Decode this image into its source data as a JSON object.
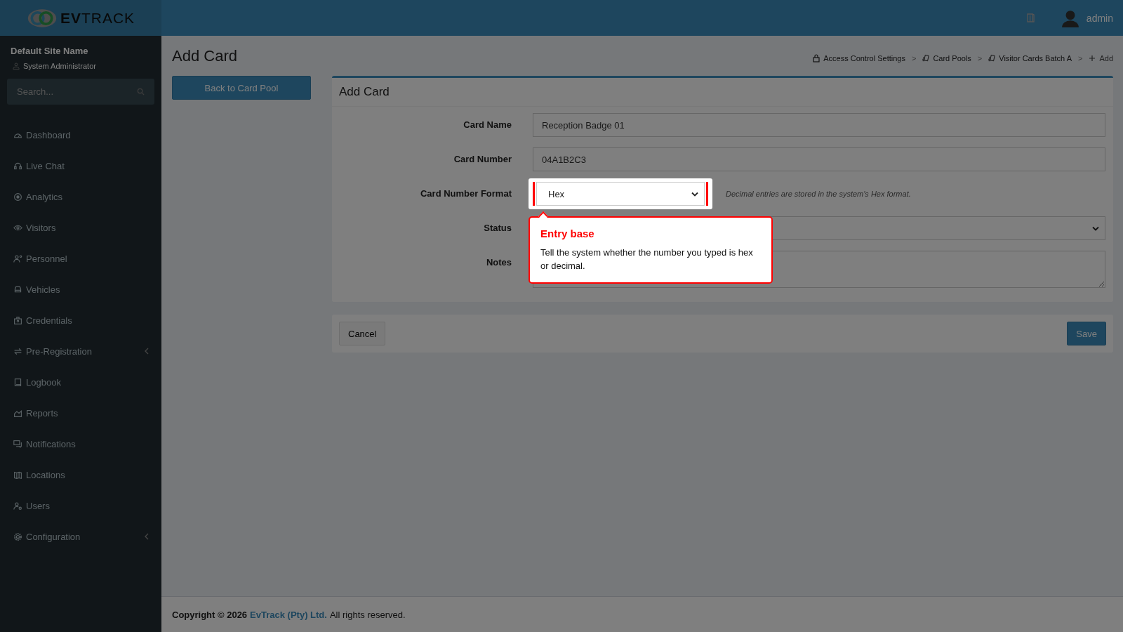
{
  "header": {
    "logo_text": "**EV**TRACK",
    "user": "admin"
  },
  "sidebar": {
    "site_name": "Default Site Name",
    "role": "System Administrator",
    "search": {
      "placeholder": "Search..."
    },
    "items": [
      {
        "label": "Dashboard",
        "has_submenu": false
      },
      {
        "label": "Live Chat",
        "has_submenu": false
      },
      {
        "label": "Analytics",
        "has_submenu": false
      },
      {
        "label": "Visitors",
        "has_submenu": false
      },
      {
        "label": "Personnel",
        "has_submenu": false
      },
      {
        "label": "Vehicles",
        "has_submenu": false
      },
      {
        "label": "Credentials",
        "has_submenu": false
      },
      {
        "label": "Pre-Registration",
        "has_submenu": true
      },
      {
        "label": "Logbook",
        "has_submenu": false
      },
      {
        "label": "Reports",
        "has_submenu": false
      },
      {
        "label": "Notifications",
        "has_submenu": false
      },
      {
        "label": "Locations",
        "has_submenu": false
      },
      {
        "label": "Users",
        "has_submenu": false
      },
      {
        "label": "Configuration",
        "has_submenu": true
      }
    ]
  },
  "page": {
    "title": "Add Card",
    "back_button": "Back to Card Pool",
    "breadcrumb": {
      "separator": ">",
      "items": [
        {
          "label": "Access Control Settings",
          "kind": "lock"
        },
        {
          "label": "Card Pools",
          "kind": "cards"
        },
        {
          "label": "Visitor Cards Batch A",
          "kind": "cards"
        },
        {
          "label": "Add",
          "kind": "add"
        }
      ]
    }
  },
  "form": {
    "title": "Add Card",
    "fields": [
      {
        "label": "Card Name",
        "kind": "text",
        "value": "Reception Badge 01",
        "spotlight": false
      },
      {
        "label": "Card Number",
        "kind": "text",
        "value": "04A1B2C3",
        "spotlight": false
      },
      {
        "label": "Card Number Format",
        "kind": "select",
        "value": "Hex",
        "hint": "Decimal entries are stored in the system's Hex format.",
        "spotlight": true
      },
      {
        "label": "Status",
        "kind": "select",
        "spotlight": false
      },
      {
        "label": "Notes",
        "kind": "textarea",
        "spotlight": false
      }
    ],
    "cancel": "Cancel",
    "save": "Save"
  },
  "tour": {
    "title": "Entry base",
    "text": "Tell the system whether the number you typed is hex or decimal."
  },
  "footer": {
    "copyright": "Copyright © 2026",
    "company": "EvTrack (Pty) Ltd.",
    "rights": "All rights reserved."
  }
}
